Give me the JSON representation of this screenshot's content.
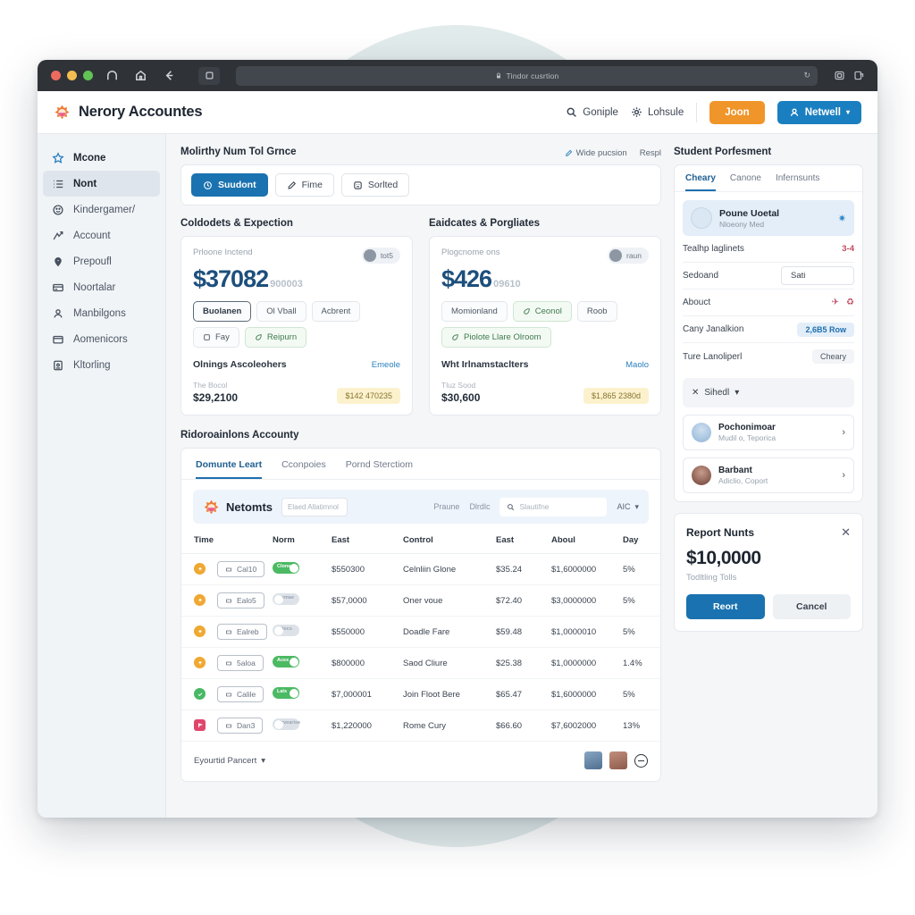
{
  "browser": {
    "url_text": "Tindor cusrtion",
    "nav_icons": [
      "arc-icon",
      "home-icon",
      "back-arrow-icon"
    ],
    "reload_label": "↻",
    "right_icons": [
      "sidebar-toggle-icon",
      "share-icon"
    ]
  },
  "app": {
    "brand": "Nerory Accountes",
    "header_links": [
      {
        "label": "Goniple",
        "icon": "search-icon"
      },
      {
        "label": "Lohsule",
        "icon": "gear-icon"
      }
    ],
    "primary_action": "Joon",
    "account_button": "Netwell",
    "account_caret": "▾"
  },
  "sidebar": {
    "items": [
      {
        "label": "Mcone",
        "icon": "star-icon",
        "state": "header"
      },
      {
        "label": "Nont",
        "icon": "list-icon",
        "state": "active"
      },
      {
        "label": "Kindergamer/",
        "icon": "smiley-icon",
        "state": "normal"
      },
      {
        "label": "Account",
        "icon": "activity-icon",
        "state": "normal"
      },
      {
        "label": "Prepoufl",
        "icon": "location-pin-icon",
        "state": "normal"
      },
      {
        "label": "Noortalar",
        "icon": "card-icon",
        "state": "normal"
      },
      {
        "label": "Manbilgons",
        "icon": "person-icon",
        "state": "normal"
      },
      {
        "label": "Aomenicors",
        "icon": "folder-icon",
        "state": "normal"
      },
      {
        "label": "Kltorling",
        "icon": "clipboard-icon",
        "state": "normal"
      }
    ]
  },
  "main": {
    "page_title": "Molirthy Num Tol Grnce",
    "top_right_links": [
      {
        "label": "Wide pucsion",
        "icon": "edit-icon"
      },
      {
        "label": "Respl",
        "icon": ""
      }
    ],
    "filter_chips": [
      {
        "label": "Suudont",
        "icon": "clock-icon",
        "active": true
      },
      {
        "label": "Fime",
        "icon": "pencil-icon",
        "active": false
      },
      {
        "label": "Sorlted",
        "icon": "smiley-icon",
        "active": false
      }
    ],
    "cards_section_titles": [
      "Coldodets & Expection",
      "Eaidcates & Porgliates"
    ],
    "cards": [
      {
        "label": "Prloone Inctend",
        "avatar_pill": "tot5",
        "value": "$37082",
        "value_suffix": "900003",
        "tags": [
          {
            "label": "Buolanen",
            "style": "dark"
          },
          {
            "label": "Ol Vball",
            "style": "plain"
          },
          {
            "label": "Acbrent",
            "style": "plain"
          },
          {
            "label": "Fay",
            "style": "plain",
            "icon": "box-icon"
          },
          {
            "label": "Reipurn",
            "style": "green",
            "icon": "leaf-icon"
          }
        ],
        "sub_label": "Olnings Ascoleohers",
        "sub_link": "Emeole",
        "foot_small": "The Bocol",
        "foot_big": "$29,2100",
        "foot_pill": "$142 470235"
      },
      {
        "label": "Plogcnome ons",
        "avatar_pill": "raun",
        "value": "$426",
        "value_suffix": "09610",
        "tags": [
          {
            "label": "Momionland",
            "style": "plain"
          },
          {
            "label": "Ceonol",
            "style": "green",
            "icon": "leaf-icon"
          },
          {
            "label": "Roob",
            "style": "plain"
          },
          {
            "label": "Piolote Llare Olroom",
            "style": "green",
            "icon": "leaf-icon"
          }
        ],
        "sub_label": "Wht Irlnamstaclters",
        "sub_link": "Maolo",
        "foot_small": "Tluz Sood",
        "foot_big": "$30,600",
        "foot_pill": "$1,865 2380d"
      }
    ],
    "table_section_title": "Ridoroainlons Accounty",
    "table_tabs": [
      {
        "label": "Domunte Leart",
        "active": true
      },
      {
        "label": "Cconpoies",
        "active": false
      },
      {
        "label": "Pornd Sterctiom",
        "active": false
      }
    ],
    "toolbar": {
      "brand": "Netomts",
      "input_value": "Elaed Allatimnol",
      "links": [
        "Praune",
        "Dlrdlc"
      ],
      "search_placeholder": "Slautifne",
      "select_value": "AIC",
      "select_caret": "▾"
    },
    "table": {
      "columns": [
        "Time",
        "Norm",
        "East",
        "Control",
        "East",
        "Aboul",
        "Day"
      ],
      "rows": [
        {
          "status": "orange",
          "status_icon": "up-arrow-icon",
          "pill": "Cal10",
          "pill_icon": "tag-icon",
          "toggle": "on",
          "toggle_label": "Clone",
          "east1": "$550300",
          "control": "Celnliin Glone",
          "east2": "$35.24",
          "aboul": "$1,6000000",
          "day": "5%"
        },
        {
          "status": "orange",
          "status_icon": "up-arrow-icon",
          "pill": "Ealo5",
          "pill_icon": "tag-icon",
          "toggle": "off",
          "toggle_label": "Demae",
          "east1": "$57,0000",
          "control": "Oner voue",
          "east2": "$72.40",
          "aboul": "$3,0000000",
          "day": "5%"
        },
        {
          "status": "orange",
          "status_icon": "up-arrow-icon",
          "pill": "Ealreb",
          "pill_icon": "tag-icon",
          "toggle": "off",
          "toggle_label": "Litecs",
          "east1": "$550000",
          "control": "Doadle Fare",
          "east2": "$59.48",
          "aboul": "$1,0000010",
          "day": "5%"
        },
        {
          "status": "orange",
          "status_icon": "up-arrow-icon",
          "pill": "5aloa",
          "pill_icon": "tag-icon",
          "toggle": "on",
          "toggle_label": "Aces",
          "east1": "$800000",
          "control": "Saod Cliure",
          "east2": "$25.38",
          "aboul": "$1,0000000",
          "day": "1.4%"
        },
        {
          "status": "green",
          "status_icon": "check-icon",
          "pill": "Calile",
          "pill_icon": "tag-icon",
          "toggle": "on",
          "toggle_label": "Lals",
          "east1": "$7,000001",
          "control": "Join Floot Bere",
          "east2": "$65.47",
          "aboul": "$1,6000000",
          "day": "5%"
        },
        {
          "status": "red",
          "status_icon": "flag-icon",
          "pill": "Dan3",
          "pill_icon": "tag-icon",
          "toggle": "off",
          "toggle_label": "Brvearise",
          "east1": "$1,220000",
          "control": "Rome Cury",
          "east2": "$66.60",
          "aboul": "$7,6002000",
          "day": "13%"
        }
      ],
      "footer_select": "Eyourtid Pancert",
      "footer_caret": "▾",
      "footer_avatars": [
        "avatar-male",
        "avatar-female"
      ],
      "footer_button_icon": "minus-circle-icon"
    }
  },
  "right_panel": {
    "title": "Student Porfesment",
    "tabs": [
      {
        "label": "Cheary",
        "active": true
      },
      {
        "label": "Canone",
        "active": false
      },
      {
        "label": "Infernsunts",
        "active": false
      }
    ],
    "highlight": {
      "name": "Poune Uoetal",
      "sub": "Nloeony Med",
      "action_icon": "sparkle-icon"
    },
    "rows": [
      {
        "label": "Tealhp laglinets",
        "type": "red",
        "value": "3-4"
      },
      {
        "label": "Sedoand",
        "type": "input",
        "value": "Sati"
      },
      {
        "label": "Abouct",
        "type": "icons",
        "value": "✈  ♻"
      },
      {
        "label": "Cany Janalkion",
        "type": "blue",
        "value": "2,6B5 Row"
      },
      {
        "label": "Ture Lanoliperl",
        "type": "chip",
        "value": "Cheary"
      }
    ],
    "select_box": {
      "label": "Sihedl",
      "icon": "close-icon",
      "caret": "▾"
    },
    "people": [
      {
        "name": "Pochonimoar",
        "sub": "Mudil o, Teporica",
        "chevron": "›"
      },
      {
        "name": "Barbant",
        "sub": "Adiclio, Coport",
        "chevron": "›"
      }
    ],
    "report": {
      "title": "Report Nunts",
      "close": "✕",
      "amount": "$10,0000",
      "subtitle": "Todltling Tolls",
      "primary": "Reort",
      "secondary": "Cancel"
    }
  }
}
